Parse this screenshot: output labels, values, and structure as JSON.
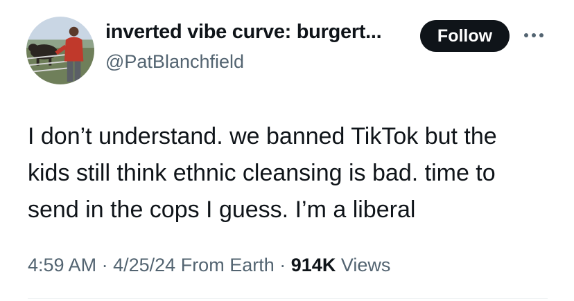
{
  "author": {
    "display_name": "inverted vibe curve: burgert...",
    "handle": "@PatBlanchfield",
    "avatar_icon": "profile-photo-person-with-cows"
  },
  "actions": {
    "follow_label": "Follow",
    "more_icon": "more-horizontal-icon"
  },
  "tweet": {
    "lines": [
      "I don’t understand. we banned TikTok but the",
      "kids still think ethnic cleansing is bad. time to",
      "send in the cops I guess. I’m a liberal"
    ]
  },
  "meta": {
    "time": "4:59 AM",
    "separator": "·",
    "date": "4/25/24",
    "source": "From Earth",
    "views_count": "914K",
    "views_label": "Views"
  },
  "colors": {
    "text_primary": "#0f1419",
    "text_secondary": "#536471",
    "button_bg": "#0f1419",
    "button_text": "#ffffff"
  }
}
